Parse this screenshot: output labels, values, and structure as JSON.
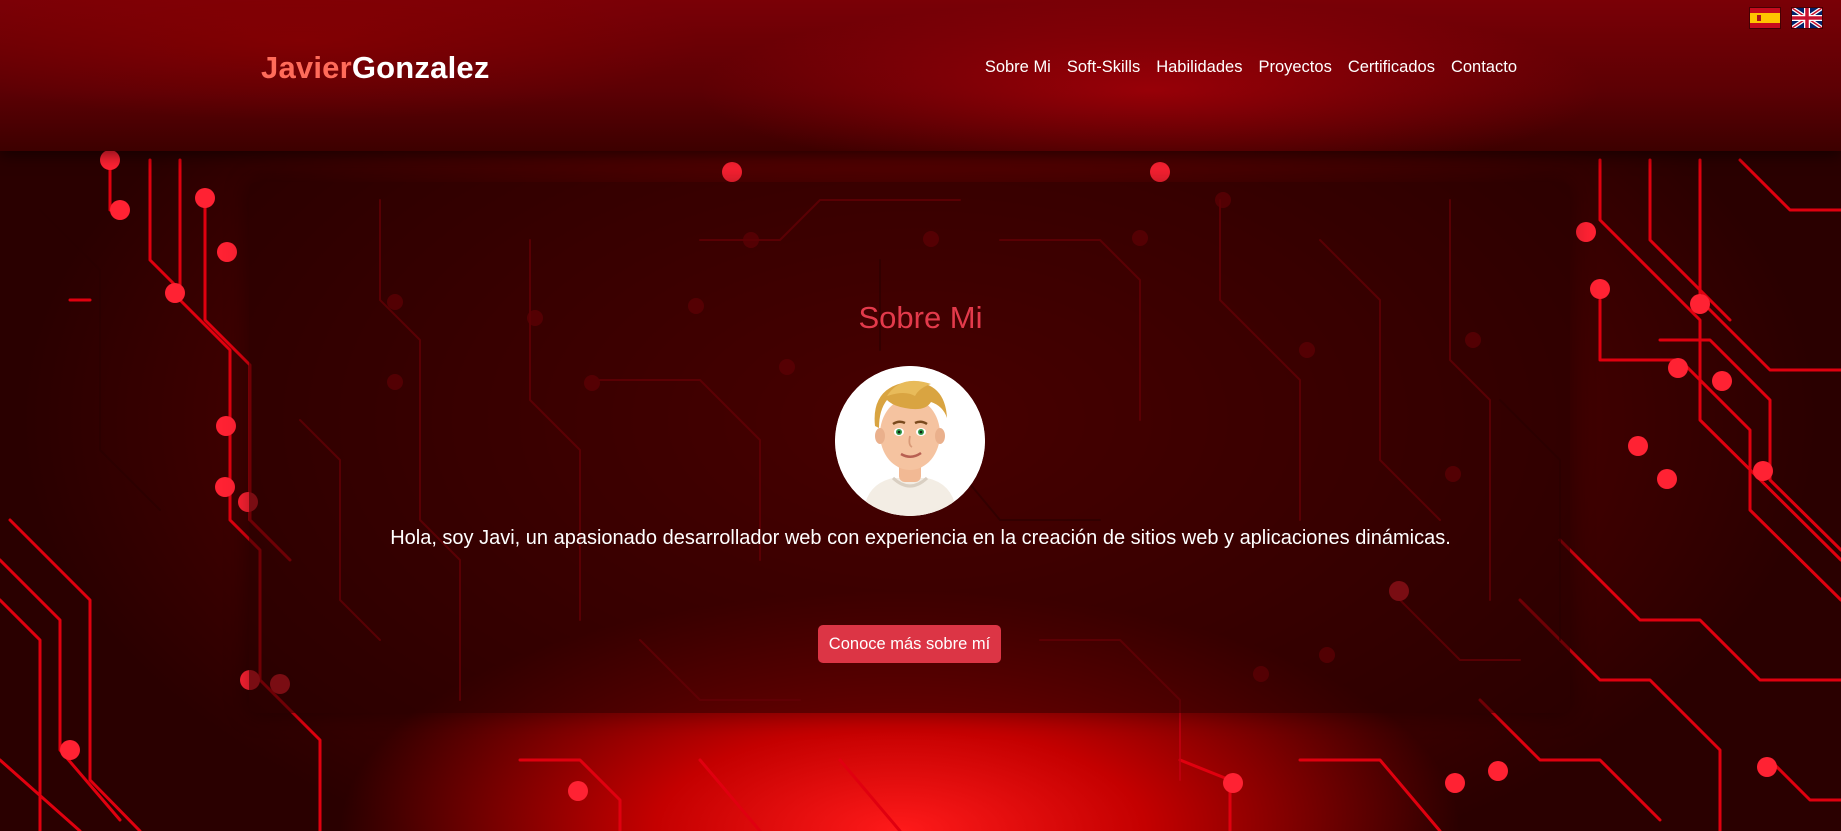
{
  "header": {
    "logo_first": "Javier",
    "logo_last": "Gonzalez",
    "nav": [
      {
        "label": "Sobre Mi"
      },
      {
        "label": "Soft-Skills"
      },
      {
        "label": "Habilidades"
      },
      {
        "label": "Proyectos"
      },
      {
        "label": "Certificados"
      },
      {
        "label": "Contacto"
      }
    ],
    "languages": [
      {
        "icon": "spain-flag-icon"
      },
      {
        "icon": "uk-flag-icon"
      }
    ]
  },
  "hero": {
    "title": "Sobre Mi",
    "avatar_icon": "avatar-illustration",
    "bio": "Hola, soy Javi, un apasionado desarrollador web con experiencia en la creación de sitios web y aplicaciones dinámicas.",
    "cta_label": "Conoce más sobre mí"
  },
  "colors": {
    "accent": "#dc3545",
    "logo_accent": "#ff6b5a",
    "background": "#4a0000",
    "title": "#e33a4b"
  }
}
